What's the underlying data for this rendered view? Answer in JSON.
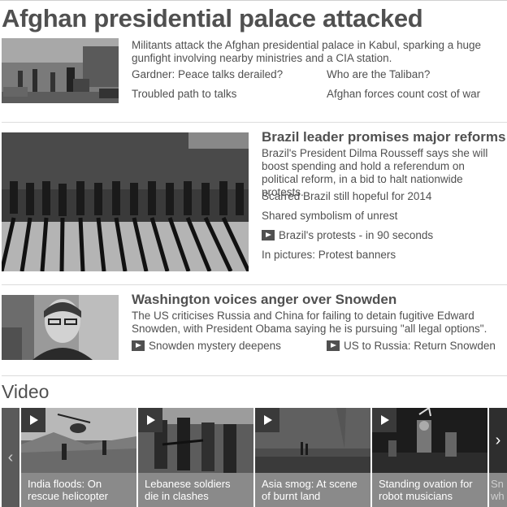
{
  "lead": {
    "headline": "Afghan presidential palace attacked",
    "summary": "Militants attack the Afghan presidential palace in Kabul, sparking a huge gunfight involving nearby ministries and a CIA station.",
    "links": [
      "Gardner: Peace talks derailed?",
      "Who are the Taliban?",
      "Troubled path to talks",
      "Afghan forces count cost of war"
    ]
  },
  "brazil": {
    "title": "Brazil leader promises major reforms",
    "summary": "Brazil's President Dilma Rousseff says she will boost spending and hold a referendum on political reform, in a bid to halt nationwide protests.",
    "links": [
      "Scarred Brazil still hopeful for 2014",
      "Shared symbolism of unrest",
      "Brazil's protests - in 90 seconds",
      "In pictures: Protest banners"
    ]
  },
  "snowden": {
    "title": "Washington voices anger over Snowden",
    "summary": "The US criticises Russia and China for failing to detain fugitive Edward Snowden, with President Obama saying he is pursuing \"all legal options\".",
    "links": [
      "Snowden mystery deepens",
      "US to Russia: Return Snowden"
    ]
  },
  "video": {
    "section_title": "Video",
    "cards": [
      {
        "caption": "India floods: On rescue helicopter"
      },
      {
        "caption": "Lebanese soldiers die in clashes"
      },
      {
        "caption": "Asia smog: At scene of burnt land"
      },
      {
        "caption": "Standing ovation for robot musicians"
      },
      {
        "caption": "Sn wh"
      }
    ],
    "prev_glyph": "‹",
    "next_glyph": "›"
  }
}
